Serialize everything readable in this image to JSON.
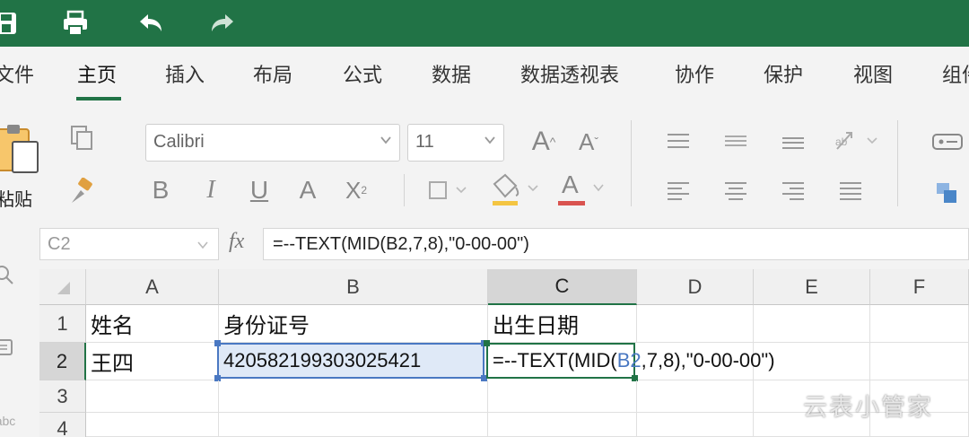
{
  "title_bar": {
    "icons": [
      "save-icon",
      "print-icon",
      "undo-icon",
      "redo-icon"
    ],
    "color": "#217346"
  },
  "tabs": [
    "文件",
    "主页",
    "插入",
    "布局",
    "公式",
    "数据",
    "数据透视表",
    "协作",
    "保护",
    "视图",
    "组件"
  ],
  "active_tab": "主页",
  "ribbon": {
    "paste_label": "粘贴",
    "font_name": "Calibri",
    "font_size": "11",
    "bold": "B",
    "italic": "I",
    "underline": "U",
    "strike": "A",
    "subscript": "X",
    "grow_font": "A",
    "shrink_font": "A",
    "font_color": "A"
  },
  "formula_bar": {
    "name_box": "C2",
    "fx": "fx",
    "formula": "=--TEXT(MID(B2,7,8),\"0-00-00\")"
  },
  "sheet": {
    "columns": [
      "A",
      "B",
      "C",
      "D",
      "E",
      "F"
    ],
    "rows": [
      "1",
      "2",
      "3",
      "4"
    ],
    "cells": {
      "A1": "姓名",
      "B1": "身份证号",
      "C1": "出生日期",
      "A2": "王四",
      "B2": "420582199303025421",
      "C2_prefix": "=--TEXT(MID(",
      "C2_ref": "B2",
      "C2_suffix": ",7,8),\"0-00-00\")"
    },
    "selected_cell": "C2",
    "accent_color": "#217346",
    "ref_color": "#4a78c2"
  },
  "watermark": "云表小管家"
}
